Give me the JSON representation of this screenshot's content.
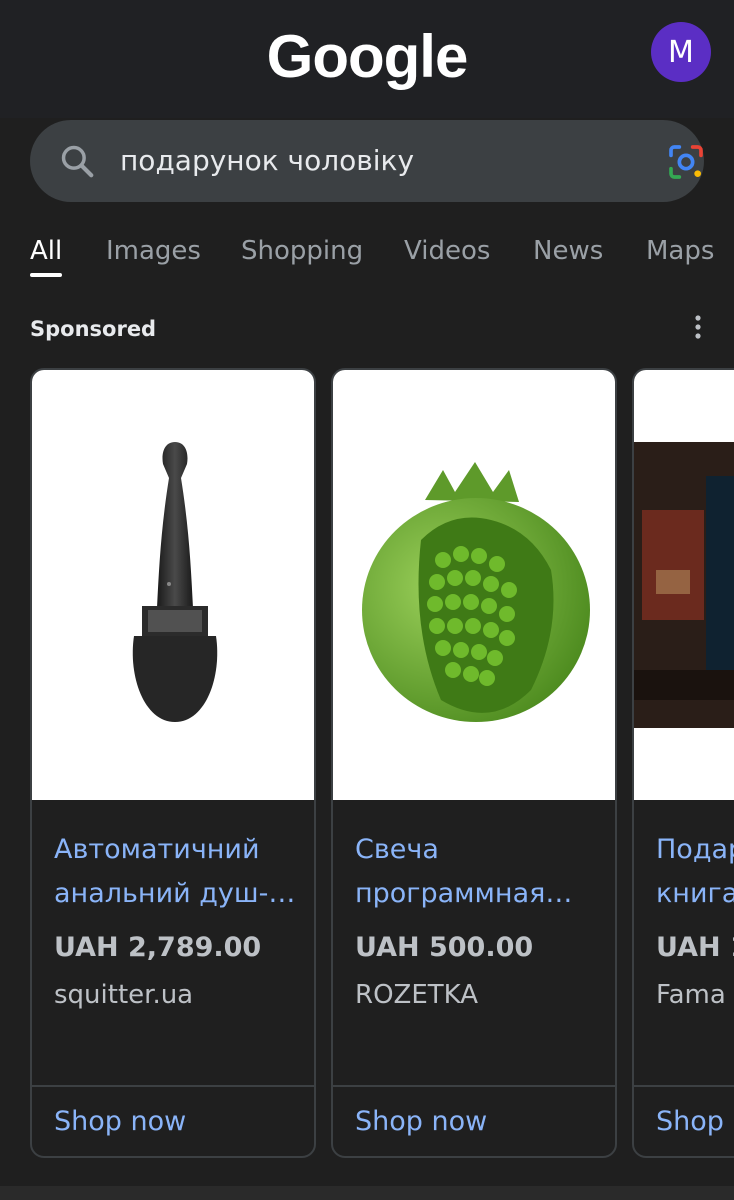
{
  "header": {
    "logo_text": "Google",
    "avatar_letter": "M"
  },
  "search": {
    "query": "подарунок чоловіку",
    "search_icon": "search-icon",
    "lens_icon": "google-lens-icon"
  },
  "tabs": [
    {
      "label": "All",
      "active": true
    },
    {
      "label": "Images"
    },
    {
      "label": "Shopping"
    },
    {
      "label": "Videos"
    },
    {
      "label": "News"
    },
    {
      "label": "Maps"
    }
  ],
  "sponsored": {
    "label": "Sponsored",
    "more_icon": "more-vert-icon"
  },
  "products": [
    {
      "title_line1": "Автоматичний",
      "title_line2": "анальний душ-…",
      "price": "UAH 2,789.00",
      "store": "squitter.ua",
      "cta": "Shop now"
    },
    {
      "title_line1": "Свеча",
      "title_line2": "программная…",
      "price": "UAH 500.00",
      "store": "ROZETKA",
      "cta": "Shop now"
    },
    {
      "title_line1": "Подар",
      "title_line2": "книга",
      "price": "UAH 1",
      "store": "Fama",
      "cta": "Shop"
    }
  ],
  "colors": {
    "background": "#1f1f1f",
    "link": "#8ab4f8",
    "avatar": "#5b2ec4",
    "search_bg": "#3c4043"
  }
}
